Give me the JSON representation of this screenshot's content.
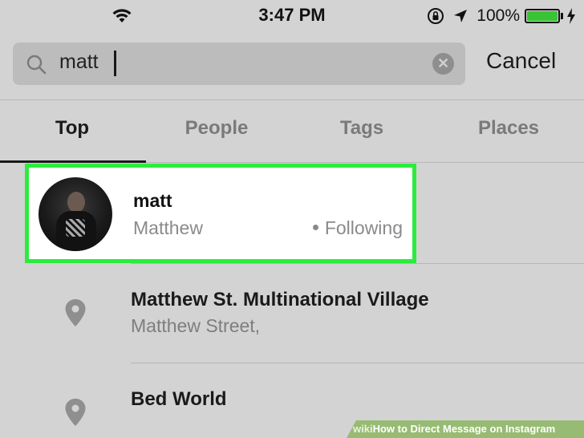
{
  "status_bar": {
    "time": "3:47 PM",
    "battery_percent": "100%",
    "battery_level": 1.0,
    "battery_color": "#39c435"
  },
  "search": {
    "query": "matt",
    "cancel_label": "Cancel"
  },
  "tabs": [
    {
      "label": "Top",
      "active": true
    },
    {
      "label": "People",
      "active": false
    },
    {
      "label": "Tags",
      "active": false
    },
    {
      "label": "Places",
      "active": false
    }
  ],
  "results": {
    "user": {
      "username": "matt",
      "full_name": "Matthew",
      "status": "Following",
      "highlight_color": "#2bec3c"
    },
    "places": [
      {
        "title": "Matthew St. Multinational Village",
        "subtitle": "Matthew Street,"
      },
      {
        "title": "Bed World",
        "subtitle": ""
      }
    ]
  },
  "watermark": {
    "wiki": "wiki",
    "how": "How",
    "rest": " to Direct Message on Instagram"
  }
}
